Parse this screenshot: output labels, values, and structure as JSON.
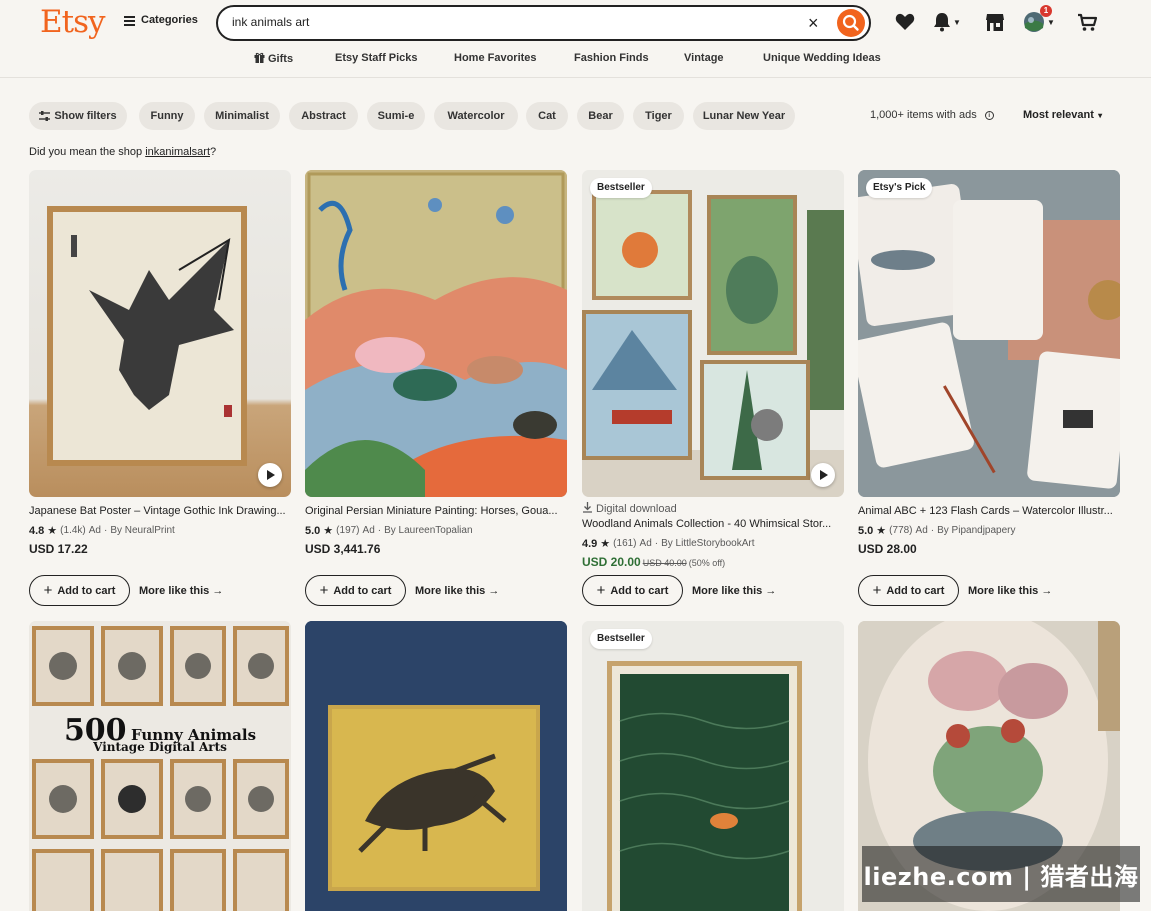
{
  "header": {
    "logo": "Etsy",
    "categories_label": "Categories",
    "search": {
      "value": "ink animals art",
      "clear": "×"
    },
    "cart_badge": "1"
  },
  "nav": [
    {
      "label": "Gifts",
      "icon": "gift-icon"
    },
    {
      "label": "Etsy Staff Picks"
    },
    {
      "label": "Home Favorites"
    },
    {
      "label": "Fashion Finds"
    },
    {
      "label": "Vintage"
    },
    {
      "label": "Unique Wedding Ideas"
    }
  ],
  "filters": {
    "show_filters": "Show filters",
    "chips": [
      "Funny",
      "Minimalist",
      "Abstract",
      "Sumi-e",
      "Watercolor",
      "Cat",
      "Bear",
      "Tiger",
      "Lunar New Year"
    ],
    "results_count": "1,000+ items with ads",
    "sort": "Most relevant"
  },
  "suggestion": {
    "prefix": "Did you mean the shop",
    "shop": "inkanimalsart",
    "suffix": "?"
  },
  "products": [
    {
      "title": "Japanese Bat Poster – Vintage Gothic Ink Drawing...",
      "rating": "4.8",
      "reviews": "(1.4k)",
      "ad": "Ad",
      "seller": "By NeuralPrint",
      "price": "USD 17.22",
      "has_video": true,
      "badge": ""
    },
    {
      "title": "Original Persian Miniature Painting: Horses, Goua...",
      "rating": "5.0",
      "reviews": "(197)",
      "ad": "Ad",
      "seller": "By LaureenTopalian",
      "price": "USD 3,441.76",
      "has_video": false,
      "badge": ""
    },
    {
      "title": "Woodland Animals Collection - 40 Whimsical Stor...",
      "digital": "Digital download",
      "rating": "4.9",
      "reviews": "(161)",
      "ad": "Ad",
      "seller": "By LittleStorybookArt",
      "price": "USD 20.00",
      "original_price": "USD 40.00",
      "discount": "(50% off)",
      "has_video": true,
      "badge": "Bestseller"
    },
    {
      "title": "Animal ABC + 123 Flash Cards – Watercolor Illustr...",
      "rating": "5.0",
      "reviews": "(778)",
      "ad": "Ad",
      "seller": "By Pipandjpapery",
      "price": "USD 28.00",
      "has_video": false,
      "badge": "Etsy's Pick"
    }
  ],
  "second_row": [
    {
      "badge": "",
      "image_text": {
        "line1_num": "500",
        "line1_rest": "Funny Animals",
        "line2": "Vintage Digital Arts"
      }
    },
    {
      "badge": ""
    },
    {
      "badge": "Bestseller"
    },
    {
      "badge": ""
    }
  ],
  "card_actions": {
    "add_to_cart": "Add to cart",
    "more_like_this": "More like this",
    "arrow": "→"
  },
  "watermark": "liezhe.com | 猎者出海",
  "colors": {
    "brand": "#f1641e",
    "background": "#f7f5f1",
    "sale": "#2f6f35"
  }
}
